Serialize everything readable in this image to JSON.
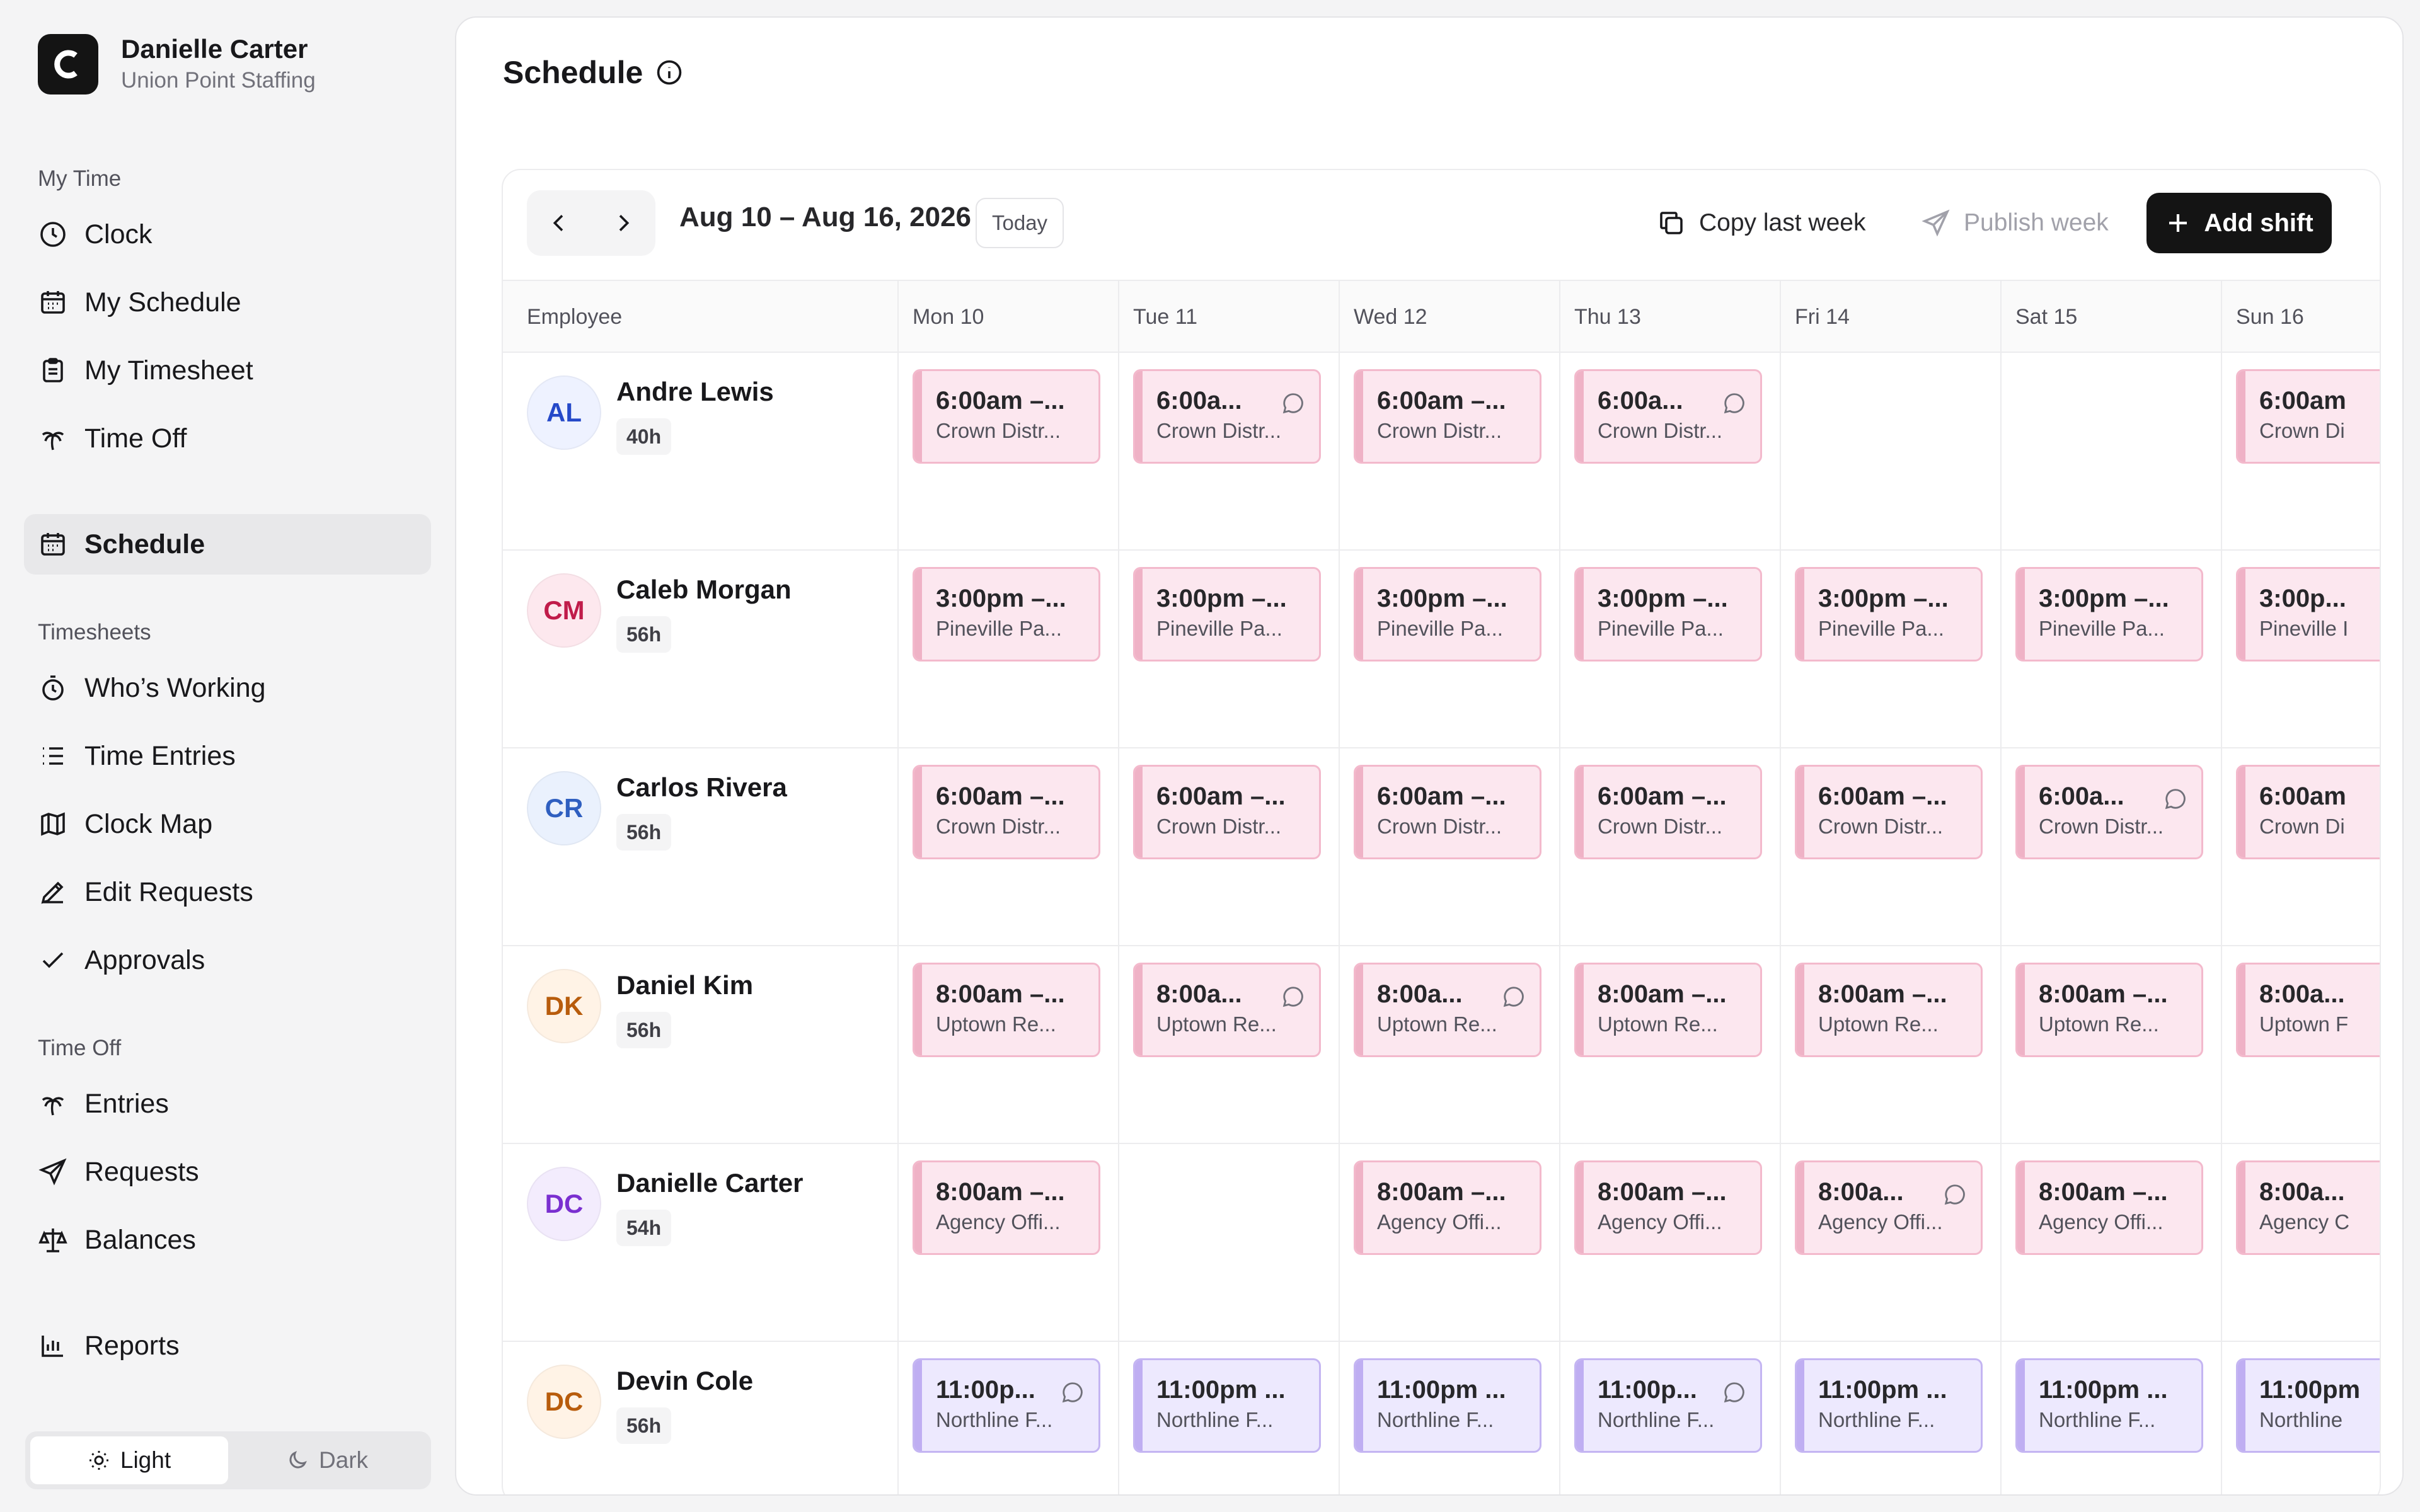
{
  "org": {
    "user": "Danielle Carter",
    "company": "Union Point Staffing",
    "logo_letter": "C"
  },
  "nav": {
    "my_time": {
      "title": "My Time",
      "items": [
        "Clock",
        "My Schedule",
        "My Timesheet",
        "Time Off"
      ]
    },
    "schedule": "Schedule",
    "timesheets": {
      "title": "Timesheets",
      "items": [
        "Who’s Working",
        "Time Entries",
        "Clock Map",
        "Edit Requests",
        "Approvals"
      ]
    },
    "time_off": {
      "title": "Time Off",
      "items": [
        "Entries",
        "Requests",
        "Balances"
      ]
    },
    "reports": "Reports"
  },
  "theme": {
    "light": "Light",
    "dark": "Dark",
    "selected": "light"
  },
  "page": {
    "title": "Schedule"
  },
  "toolbar": {
    "date_range": "Aug 10 – Aug 16, 2026",
    "today": "Today",
    "copy_last_week": "Copy last week",
    "publish_week": "Publish week",
    "add_shift": "Add shift"
  },
  "columns": {
    "employee": "Employee",
    "days": [
      "Mon 10",
      "Tue 11",
      "Wed 12",
      "Thu 13",
      "Fri 14",
      "Sat 15",
      "Sun 16"
    ]
  },
  "colors": {
    "pink_shift": "#fce7ef",
    "purple_shift": "#ede9fe",
    "primary": "#141414"
  },
  "employees": [
    {
      "initials": "AL",
      "name": "Andre Lewis",
      "hours": "40h",
      "avatar_bg": "#eef2ff",
      "avatar_fg": "#2549c9",
      "shifts": [
        {
          "day": 0,
          "time": "6:00am –...",
          "loc": "Crown Distr...",
          "color": "pink",
          "note": false
        },
        {
          "day": 1,
          "time": "6:00a...",
          "loc": "Crown Distr...",
          "color": "pink",
          "note": true
        },
        {
          "day": 2,
          "time": "6:00am –...",
          "loc": "Crown Distr...",
          "color": "pink",
          "note": false
        },
        {
          "day": 3,
          "time": "6:00a...",
          "loc": "Crown Distr...",
          "color": "pink",
          "note": true
        },
        {
          "day": 6,
          "time": "6:00am",
          "loc": "Crown Di",
          "color": "pink",
          "note": false
        }
      ]
    },
    {
      "initials": "CM",
      "name": "Caleb Morgan",
      "hours": "56h",
      "avatar_bg": "#fde8ee",
      "avatar_fg": "#c01c4a",
      "shifts": [
        {
          "day": 0,
          "time": "3:00pm –...",
          "loc": "Pineville Pa...",
          "color": "pink",
          "note": false
        },
        {
          "day": 1,
          "time": "3:00pm –...",
          "loc": "Pineville Pa...",
          "color": "pink",
          "note": false
        },
        {
          "day": 2,
          "time": "3:00pm –...",
          "loc": "Pineville Pa...",
          "color": "pink",
          "note": false
        },
        {
          "day": 3,
          "time": "3:00pm –...",
          "loc": "Pineville Pa...",
          "color": "pink",
          "note": false
        },
        {
          "day": 4,
          "time": "3:00pm –...",
          "loc": "Pineville Pa...",
          "color": "pink",
          "note": false
        },
        {
          "day": 5,
          "time": "3:00pm –...",
          "loc": "Pineville Pa...",
          "color": "pink",
          "note": false
        },
        {
          "day": 6,
          "time": "3:00p...",
          "loc": "Pineville I",
          "color": "pink",
          "note": false
        }
      ]
    },
    {
      "initials": "CR",
      "name": "Carlos Rivera",
      "hours": "56h",
      "avatar_bg": "#eaf1fd",
      "avatar_fg": "#2f5fc0",
      "shifts": [
        {
          "day": 0,
          "time": "6:00am –...",
          "loc": "Crown Distr...",
          "color": "pink",
          "note": false
        },
        {
          "day": 1,
          "time": "6:00am –...",
          "loc": "Crown Distr...",
          "color": "pink",
          "note": false
        },
        {
          "day": 2,
          "time": "6:00am –...",
          "loc": "Crown Distr...",
          "color": "pink",
          "note": false
        },
        {
          "day": 3,
          "time": "6:00am –...",
          "loc": "Crown Distr...",
          "color": "pink",
          "note": false
        },
        {
          "day": 4,
          "time": "6:00am –...",
          "loc": "Crown Distr...",
          "color": "pink",
          "note": false
        },
        {
          "day": 5,
          "time": "6:00a...",
          "loc": "Crown Distr...",
          "color": "pink",
          "note": true
        },
        {
          "day": 6,
          "time": "6:00am",
          "loc": "Crown Di",
          "color": "pink",
          "note": false
        }
      ]
    },
    {
      "initials": "DK",
      "name": "Daniel Kim",
      "hours": "56h",
      "avatar_bg": "#fff3e6",
      "avatar_fg": "#b85c0c",
      "shifts": [
        {
          "day": 0,
          "time": "8:00am –...",
          "loc": "Uptown Re...",
          "color": "pink",
          "note": false
        },
        {
          "day": 1,
          "time": "8:00a...",
          "loc": "Uptown Re...",
          "color": "pink",
          "note": true
        },
        {
          "day": 2,
          "time": "8:00a...",
          "loc": "Uptown Re...",
          "color": "pink",
          "note": true
        },
        {
          "day": 3,
          "time": "8:00am –...",
          "loc": "Uptown Re...",
          "color": "pink",
          "note": false
        },
        {
          "day": 4,
          "time": "8:00am –...",
          "loc": "Uptown Re...",
          "color": "pink",
          "note": false
        },
        {
          "day": 5,
          "time": "8:00am –...",
          "loc": "Uptown Re...",
          "color": "pink",
          "note": false
        },
        {
          "day": 6,
          "time": "8:00a...",
          "loc": "Uptown F",
          "color": "pink",
          "note": false
        }
      ]
    },
    {
      "initials": "DC",
      "name": "Danielle Carter",
      "hours": "54h",
      "avatar_bg": "#f3ecfd",
      "avatar_fg": "#7a2fd0",
      "shifts": [
        {
          "day": 0,
          "time": "8:00am –...",
          "loc": "Agency Offi...",
          "color": "pink",
          "note": false
        },
        {
          "day": 2,
          "time": "8:00am –...",
          "loc": "Agency Offi...",
          "color": "pink",
          "note": false
        },
        {
          "day": 3,
          "time": "8:00am –...",
          "loc": "Agency Offi...",
          "color": "pink",
          "note": false
        },
        {
          "day": 4,
          "time": "8:00a...",
          "loc": "Agency Offi...",
          "color": "pink",
          "note": true
        },
        {
          "day": 5,
          "time": "8:00am –...",
          "loc": "Agency Offi...",
          "color": "pink",
          "note": false
        },
        {
          "day": 6,
          "time": "8:00a...",
          "loc": "Agency C",
          "color": "pink",
          "note": false
        }
      ]
    },
    {
      "initials": "DC",
      "name": "Devin Cole",
      "hours": "56h",
      "avatar_bg": "#fff3e6",
      "avatar_fg": "#b85c0c",
      "shifts": [
        {
          "day": 0,
          "time": "11:00p...",
          "loc": "Northline F...",
          "color": "purple",
          "note": true
        },
        {
          "day": 1,
          "time": "11:00pm ...",
          "loc": "Northline F...",
          "color": "purple",
          "note": false
        },
        {
          "day": 2,
          "time": "11:00pm ...",
          "loc": "Northline F...",
          "color": "purple",
          "note": false
        },
        {
          "day": 3,
          "time": "11:00p...",
          "loc": "Northline F...",
          "color": "purple",
          "note": true
        },
        {
          "day": 4,
          "time": "11:00pm ...",
          "loc": "Northline F...",
          "color": "purple",
          "note": false
        },
        {
          "day": 5,
          "time": "11:00pm ...",
          "loc": "Northline F...",
          "color": "purple",
          "note": false
        },
        {
          "day": 6,
          "time": "11:00pm",
          "loc": "Northline",
          "color": "purple",
          "note": false
        }
      ]
    }
  ]
}
